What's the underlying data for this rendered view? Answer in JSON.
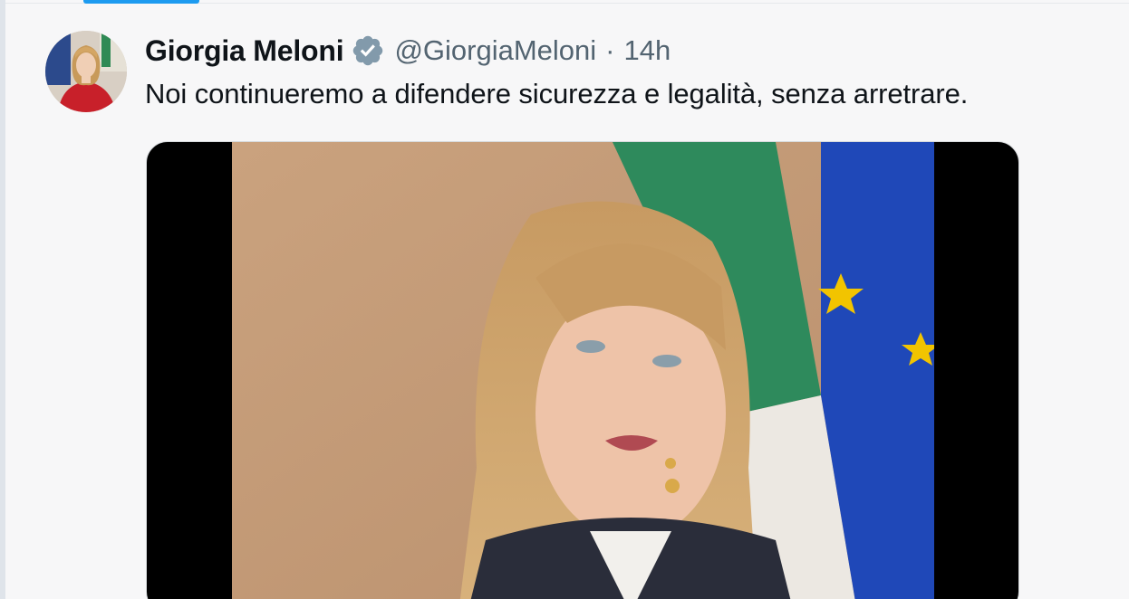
{
  "tweet": {
    "author_name": "Giorgia Meloni",
    "handle": "@GiorgiaMeloni",
    "separator": "·",
    "time": "14h",
    "text": "Noi continueremo a difendere sicurezza e legalità, senza arretrare.",
    "verified_badge_icon": "verified-badge-icon",
    "verified_badge_color": "#829aab"
  },
  "colors": {
    "accent": "#1d9bf0",
    "text": "#0f1419",
    "secondary_text": "#536471",
    "background": "#f7f7f8"
  }
}
